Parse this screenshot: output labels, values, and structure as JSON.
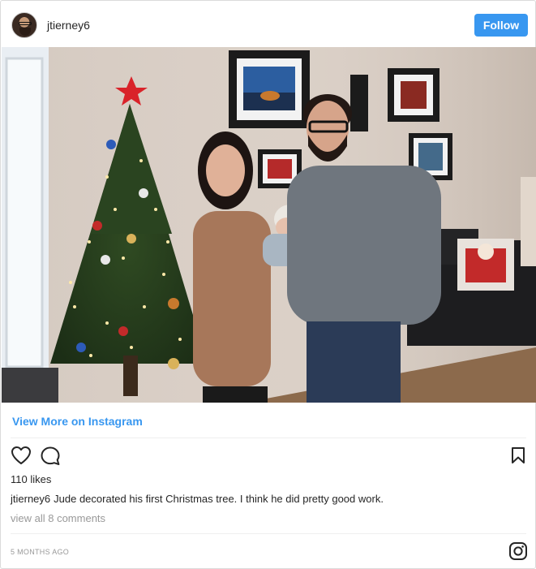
{
  "post": {
    "username": "jtierney6",
    "follow_label": "Follow",
    "view_more_label": "View More on Instagram",
    "likes": "110 likes",
    "caption_user": "jtierney6",
    "caption_text": "Jude decorated his first Christmas tree. I think he did pretty good work.",
    "comments_link": "view all 8 comments",
    "time_ago": "5 MONTHS AGO"
  },
  "icons": {
    "like": "heart-icon",
    "comment": "comment-bubble-icon",
    "save": "bookmark-icon",
    "brand": "instagram-icon"
  },
  "colors": {
    "accent": "#3897f0",
    "text": "#262626",
    "muted": "#999999",
    "border": "#dbdbdb"
  }
}
